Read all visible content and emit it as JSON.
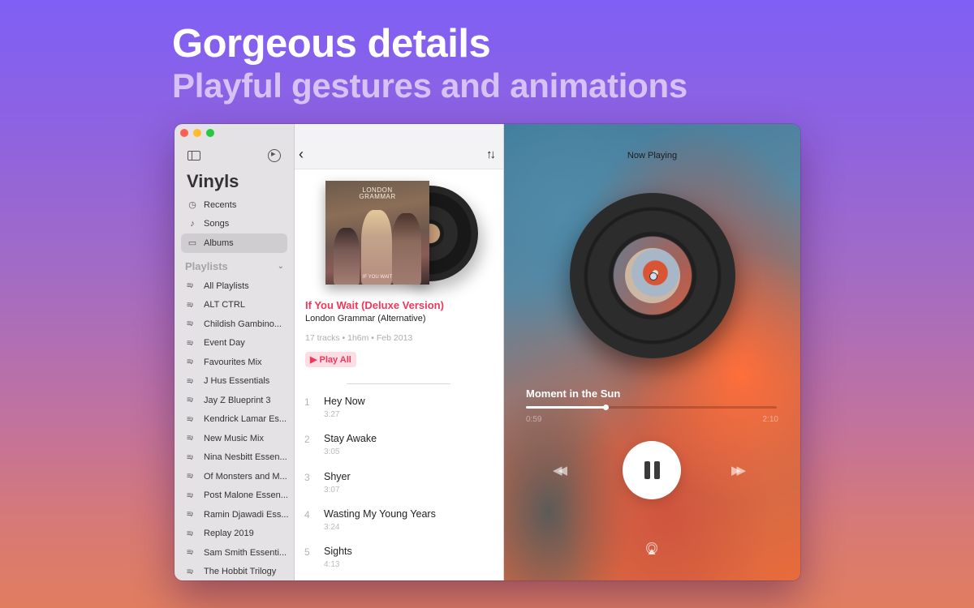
{
  "marketing": {
    "headline": "Gorgeous details",
    "subheadline": "Playful gestures and animations"
  },
  "sidebar": {
    "app_title": "Vinyls",
    "icons": {
      "toggle": "sidebar-toggle-icon",
      "settings": "settings-icon"
    },
    "nav": [
      {
        "label": "Recents",
        "icon": "clock-icon",
        "glyph": "◷",
        "active": false
      },
      {
        "label": "Songs",
        "icon": "music-note-icon",
        "glyph": "♪",
        "active": false
      },
      {
        "label": "Albums",
        "icon": "album-stack-icon",
        "glyph": "▭",
        "active": true
      }
    ],
    "playlists_header": "Playlists",
    "playlists_collapse_glyph": "⌄",
    "playlist_glyph": "≡♪",
    "playlists": [
      "All Playlists",
      "ALT CTRL",
      "Childish Gambino...",
      "Event Day",
      "Favourites Mix",
      "J Hus Essentials",
      "Jay Z Blueprint 3",
      "Kendrick Lamar Es...",
      "New Music Mix",
      "Nina Nesbitt Essen...",
      "Of Monsters and M...",
      "Post Malone Essen...",
      "Ramin Djawadi Ess...",
      "Replay 2019",
      "Sam Smith Essenti...",
      "The Hobbit Trilogy"
    ]
  },
  "album": {
    "toolbar": {
      "back_glyph": "‹",
      "sort_glyph": "↑↓"
    },
    "cover_text": {
      "band": "LONDON\nGRAMMAR",
      "title": "IF YOU WAIT"
    },
    "title": "If You Wait (Deluxe Version)",
    "artist": "London Grammar (Alternative)",
    "meta": "17 tracks • 1h6m • Feb 2013",
    "play_all": "▶ Play All",
    "accent_color": "#f0375a",
    "tracks": [
      {
        "num": "1",
        "name": "Hey Now",
        "duration": "3:27"
      },
      {
        "num": "2",
        "name": "Stay Awake",
        "duration": "3:05"
      },
      {
        "num": "3",
        "name": "Shyer",
        "duration": "3:07"
      },
      {
        "num": "4",
        "name": "Wasting My Young Years",
        "duration": "3:24"
      },
      {
        "num": "5",
        "name": "Sights",
        "duration": "4:13"
      }
    ]
  },
  "now_playing": {
    "header": "Now Playing",
    "song": "Moment in the Sun",
    "elapsed": "0:59",
    "total": "2:10",
    "progress_fraction": 0.32,
    "controls": {
      "rewind_glyph": "◀◀",
      "forward_glyph": "▶▶",
      "state": "playing"
    }
  }
}
